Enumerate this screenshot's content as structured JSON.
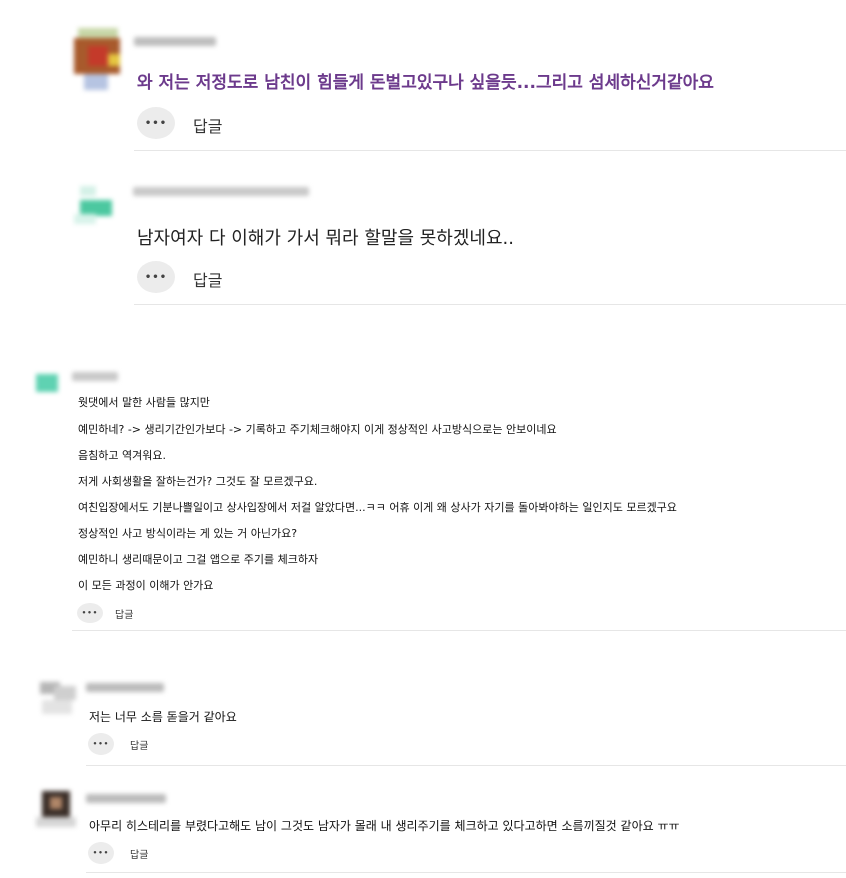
{
  "reply_label": "답글",
  "more_glyph": "•••",
  "comments": [
    {
      "text": "와 저는 저정도로 남친이 힘들게 돈벌고있구나 싶을듯...그리고 섬세하신거같아요",
      "highlight_color": "#6c3a8c"
    },
    {
      "text": "남자여자 다 이해가 가서 뭐라 할말을 못하겠네요.."
    },
    {
      "lines": [
        "웟댓에서 말한 사람들 많지만",
        "예민하네? -> 생리기간인가보다 -> 기록하고 주기체크해야지 이게 정상적인 사고방식으로는 안보이네요",
        "음침하고 역겨워요.",
        "저게 사회생활을 잘하는건가? 그것도 잘 모르겠구요.",
        "여친입장에서도 기분나쁠일이고 상사입장에서 저걸 알았다면...ㅋㅋ 어휴 이게 왜 상사가 자기를 돌아봐야하는 일인지도 모르겠구요",
        "정상적인 사고 방식이라는 게 있는 거 아닌가요?",
        "예민하니 생리때문이고 그걸 앱으로 주기를 체크하자",
        "이 모든 과정이 이해가 안가요"
      ]
    },
    {
      "text": "저는 너무 소름 돋을거 같아요"
    },
    {
      "text": "아무리 히스테리를 부렸다고해도 남이 그것도 남자가 몰래 내 생리주기를 체크하고 있다고하면 소름끼질것 같아요 ㅠㅠ"
    }
  ]
}
